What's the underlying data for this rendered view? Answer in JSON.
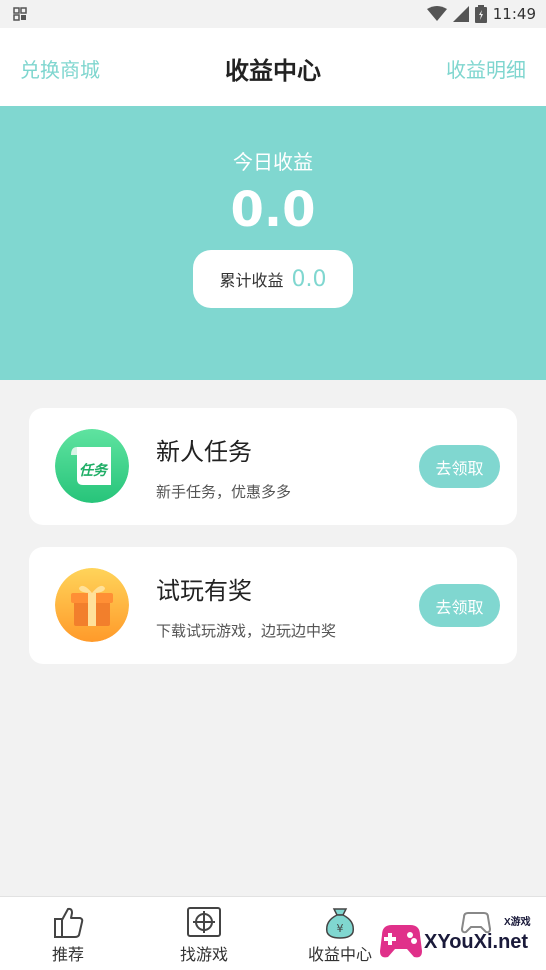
{
  "status_bar": {
    "time": "11:49"
  },
  "nav": {
    "left_link": "兑换商城",
    "title": "收益中心",
    "right_link": "收益明细"
  },
  "earnings": {
    "today_label": "今日收益",
    "today_value": "0.0",
    "total_label": "累计收益",
    "total_value": "0.0"
  },
  "tasks": [
    {
      "title": "新人任务",
      "subtitle": "新手任务，优惠多多",
      "button": "去领取",
      "icon": "task-scroll-icon",
      "icon_text": "任务"
    },
    {
      "title": "试玩有奖",
      "subtitle": "下载试玩游戏，边玩边中奖",
      "button": "去领取",
      "icon": "gift-icon"
    }
  ],
  "tabs": [
    {
      "label": "推荐",
      "icon": "thumbs-up-icon"
    },
    {
      "label": "找游戏",
      "icon": "crosshair-icon"
    },
    {
      "label": "收益中心",
      "icon": "money-bag-icon",
      "active": true
    },
    {
      "label": "",
      "icon": "gamepad-icon"
    }
  ],
  "watermark": {
    "brand": "XYouXi.net",
    "small": "X游戏"
  },
  "colors": {
    "accent": "#80d7d0",
    "background": "#f2f2f2"
  }
}
